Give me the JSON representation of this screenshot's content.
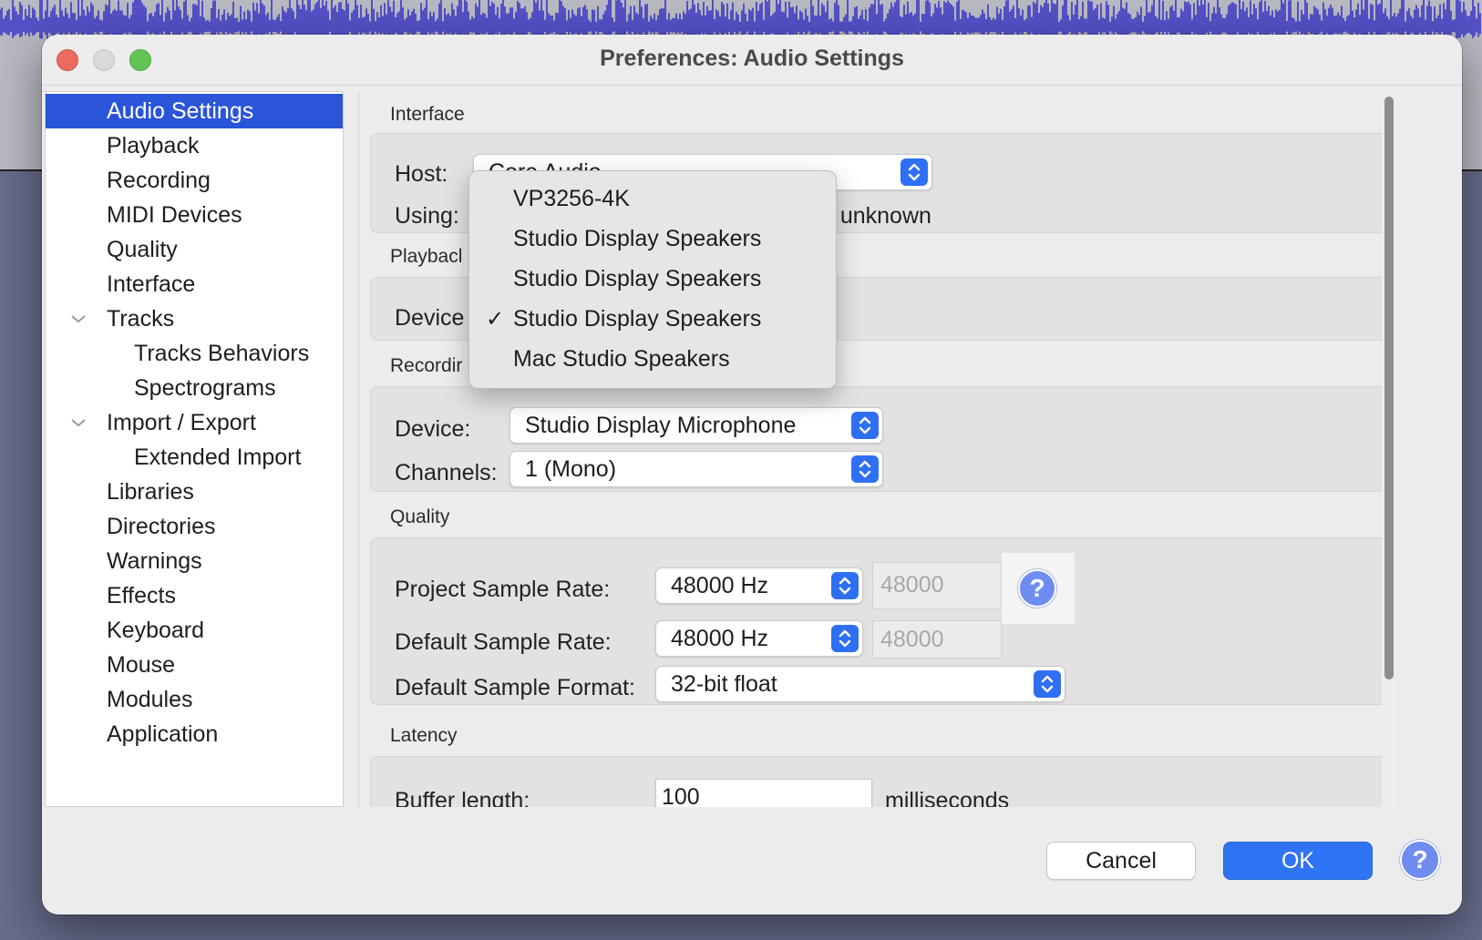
{
  "window": {
    "title": "Preferences: Audio Settings"
  },
  "sidebar": {
    "items": [
      {
        "label": "Audio Settings"
      },
      {
        "label": "Playback"
      },
      {
        "label": "Recording"
      },
      {
        "label": "MIDI Devices"
      },
      {
        "label": "Quality"
      },
      {
        "label": "Interface"
      },
      {
        "label": "Tracks"
      },
      {
        "label": "Tracks Behaviors"
      },
      {
        "label": "Spectrograms"
      },
      {
        "label": "Import / Export"
      },
      {
        "label": "Extended Import"
      },
      {
        "label": "Libraries"
      },
      {
        "label": "Directories"
      },
      {
        "label": "Warnings"
      },
      {
        "label": "Effects"
      },
      {
        "label": "Keyboard"
      },
      {
        "label": "Mouse"
      },
      {
        "label": "Modules"
      },
      {
        "label": "Application"
      }
    ]
  },
  "interface": {
    "title": "Interface",
    "host_label": "Host:",
    "host_value": "Core Audio",
    "using_label": "Using:",
    "using_value_tail": "n unknown"
  },
  "playback": {
    "title": "Playbacl",
    "device_label": "Device"
  },
  "recording": {
    "title": "Recordir",
    "device_label": "Device:",
    "device_value": "Studio Display Microphone",
    "channels_label": "Channels:",
    "channels_value": "1 (Mono)"
  },
  "quality": {
    "title": "Quality",
    "project_rate_label": "Project Sample Rate:",
    "project_rate_value": "48000 Hz",
    "project_rate_field": "48000",
    "default_rate_label": "Default Sample Rate:",
    "default_rate_value": "48000 Hz",
    "default_rate_field": "48000",
    "format_label": "Default Sample Format:",
    "format_value": "32-bit float",
    "help_glyph": "?"
  },
  "latency": {
    "title": "Latency",
    "buffer_label": "Buffer length:",
    "buffer_value": "100",
    "buffer_unit": "milliseconds"
  },
  "menu": {
    "items": [
      {
        "label": "VP3256-4K",
        "checked": false
      },
      {
        "label": "Studio Display Speakers",
        "checked": false
      },
      {
        "label": "Studio Display Speakers",
        "checked": false
      },
      {
        "label": "Studio Display Speakers",
        "checked": true
      },
      {
        "label": "Mac Studio Speakers",
        "checked": false
      }
    ],
    "check_glyph": "✓"
  },
  "footer": {
    "cancel_label": "Cancel",
    "ok_label": "OK",
    "help_glyph": "?"
  },
  "colors": {
    "selection": "#2a55d8",
    "accent": "#2f74f4",
    "waveform": "#3b37c8"
  }
}
